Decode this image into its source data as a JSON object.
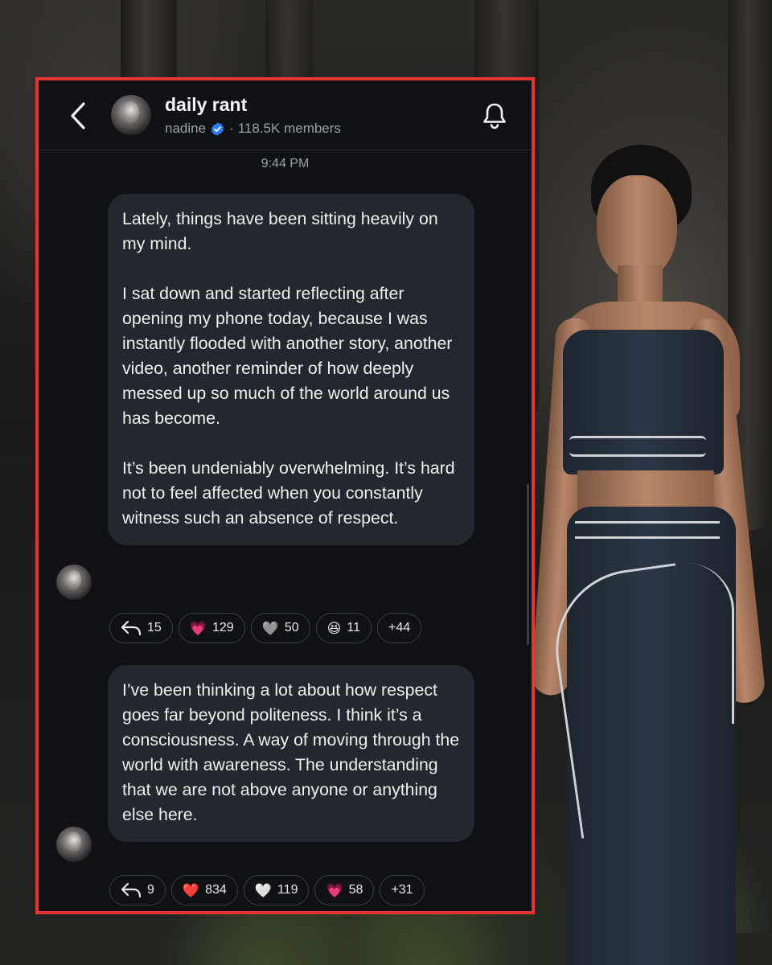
{
  "channel": {
    "title": "daily rant",
    "owner": "nadine",
    "separator": "·",
    "members": "118.5K members"
  },
  "timestamp": "9:44 PM",
  "messages": [
    {
      "paragraphs": [
        "Lately, things have been sitting heavily on my mind.",
        "I sat down and started reflecting after opening my phone today, because I was instantly flooded with another story, another video, another reminder of how deeply messed up so much of the world around us has become.",
        "It’s been undeniably overwhelming. It’s hard not to feel affected when you constantly witness such an absence of respect."
      ],
      "reply_count": "15",
      "reactions": [
        {
          "emoji": "💗",
          "count": "129"
        },
        {
          "emoji": "🩶",
          "count": "50"
        },
        {
          "emoji": "😆",
          "count": "11"
        }
      ],
      "more": "+44"
    },
    {
      "paragraphs": [
        "I’ve been thinking a lot about how respect goes far beyond politeness. I think it’s a consciousness. A way of moving through the world with awareness. The understanding that we are not above anyone or anything else here."
      ],
      "reply_count": "9",
      "reactions": [
        {
          "emoji": "❤️",
          "count": "834"
        },
        {
          "emoji": "🤍",
          "count": "119"
        },
        {
          "emoji": "💗",
          "count": "58"
        }
      ],
      "more": "+31"
    }
  ],
  "icons": {
    "back": "chevron-left-icon",
    "bell": "bell-icon",
    "verified": "verified-badge-icon",
    "reply": "reply-arrow-icon"
  },
  "colors": {
    "frame": "#e23534",
    "panel_bg": "#0f1115",
    "bubble_bg": "#24272d",
    "verified": "#2f7cf6"
  }
}
